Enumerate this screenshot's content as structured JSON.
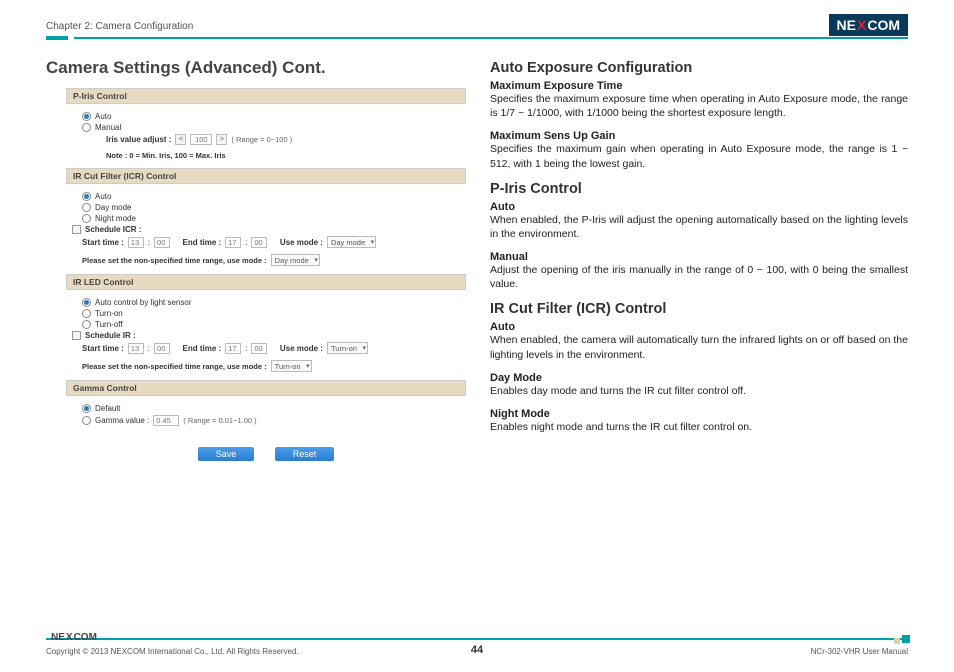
{
  "header": {
    "chapter": "Chapter 2: Camera Configuration",
    "logo_pre": "NE",
    "logo_x": "X",
    "logo_post": "COM"
  },
  "left": {
    "heading": "Camera Settings (Advanced) Cont.",
    "piris": {
      "title": "P-Iris Control",
      "auto": "Auto",
      "manual": "Manual",
      "adjust_label": "Iris value adjust :",
      "adjust_value": "100",
      "range": "( Range = 0~100 )",
      "note": "Note : 0 = Min. Iris, 100 = Max. Iris"
    },
    "icr": {
      "title": "IR Cut Filter (ICR) Control",
      "auto": "Auto",
      "day": "Day mode",
      "night": "Night mode",
      "schedule": "Schedule ICR :",
      "start_label": "Start time :",
      "start_h": "13",
      "start_m": "00",
      "end_label": "End time :",
      "end_h": "17",
      "end_m": "00",
      "use_label": "Use mode :",
      "use_value": "Day mode",
      "help": "Please set the non-specified time range, use mode :",
      "help_value": "Day mode"
    },
    "irled": {
      "title": "IR LED Control",
      "auto": "Auto control by light sensor",
      "on": "Turn-on",
      "off": "Turn-off",
      "schedule": "Schedule IR :",
      "start_label": "Start time :",
      "start_h": "13",
      "start_m": "00",
      "end_label": "End time :",
      "end_h": "17",
      "end_m": "00",
      "use_label": "Use mode :",
      "use_value": "Turn-on",
      "help": "Please set the non-specified time range, use mode :",
      "help_value": "Turn-on"
    },
    "gamma": {
      "title": "Gamma Control",
      "default": "Default",
      "gamma_label": "Gamma value :",
      "gamma_value": "0.45",
      "range": "( Range = 0.01~1.00 )"
    },
    "buttons": {
      "save": "Save",
      "reset": "Reset"
    }
  },
  "right": {
    "s1": {
      "h": "Auto Exposure Configuration",
      "sub1": "Maximum Exposure Time",
      "p1": "Specifies the maximum exposure time when operating in Auto Exposure mode, the range is 1/7 ~ 1/1000, with 1/1000 being the shortest exposure length.",
      "sub2": "Maximum Sens Up Gain",
      "p2": "Specifies the maximum gain when operating in Auto Exposure mode, the range is 1 ~ 512, with 1 being the lowest gain."
    },
    "s2": {
      "h": "P-Iris Control",
      "sub1": "Auto",
      "p1": "When enabled, the P-Iris will adjust the opening automatically based on the lighting levels in the environment.",
      "sub2": "Manual",
      "p2": "Adjust the opening of the iris manually in the range of 0 ~ 100, with 0 being the smallest value."
    },
    "s3": {
      "h": "IR Cut Filter (ICR) Control",
      "sub1": "Auto",
      "p1": "When enabled, the camera will automatically turn the infrared lights on or off based on the lighting levels in the environment.",
      "sub2": "Day Mode",
      "p2": "Enables day mode and turns the IR cut filter control off.",
      "sub3": "Night Mode",
      "p3": "Enables night mode and turns the IR cut filter control on."
    }
  },
  "footer": {
    "copyright": "Copyright © 2013 NEXCOM International Co., Ltd. All Rights Reserved.",
    "page": "44",
    "manual": "NCr-302-VHR User Manual"
  }
}
